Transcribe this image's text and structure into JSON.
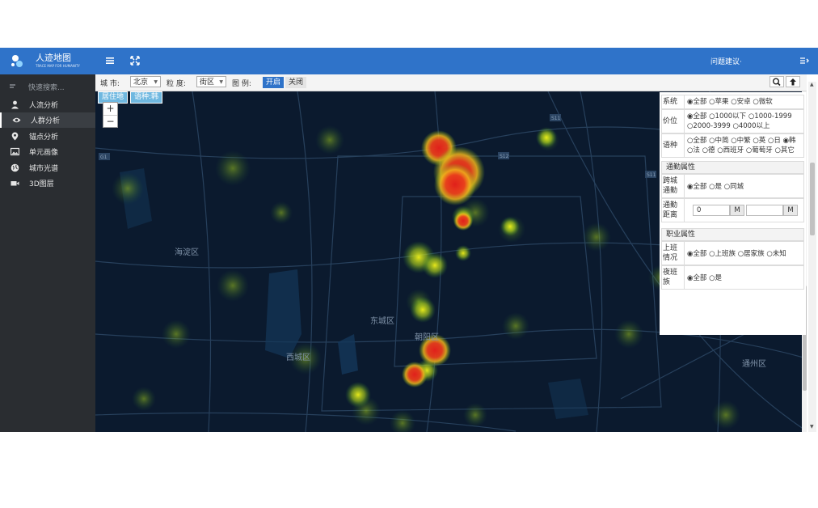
{
  "header": {
    "app_title": "人迹地图",
    "app_subtitle": "TRACE MAP FOR HUMANITY",
    "feedback": "问题建议·",
    "colors": {
      "bar": "#2f73c9",
      "sidebar": "#2a2d31"
    }
  },
  "sidebar": {
    "search_placeholder": "快速搜索...",
    "items": [
      {
        "label": "人流分析",
        "icon": "person-icon"
      },
      {
        "label": "人群分析",
        "icon": "eye-icon"
      },
      {
        "label": "锚点分析",
        "icon": "map-pin-icon"
      },
      {
        "label": "单元画像",
        "icon": "image-icon"
      },
      {
        "label": "城市光谱",
        "icon": "globe-icon"
      },
      {
        "label": "3D图层",
        "icon": "video-camera-icon"
      }
    ]
  },
  "toolbar": {
    "city_label": "城 市:",
    "city_value": "北京",
    "granularity_label": "粒 度:",
    "granularity_value": "街区",
    "legend_label": "图 例:",
    "legend_on": "开启",
    "legend_off": "关闭"
  },
  "map": {
    "tags": [
      "居住地",
      "语种:韩"
    ],
    "zoom_in": "+",
    "zoom_out": "−",
    "districts": [
      "海淀区",
      "东城区",
      "朝阳区",
      "西城区",
      "通州区"
    ],
    "road_shields": [
      "G1",
      "S11",
      "S12",
      "S11",
      "S5"
    ]
  },
  "filters": {
    "system": {
      "label": "系统",
      "options": "◉全部 ○苹果 ○安卓 ○微软"
    },
    "price": {
      "label": "价位",
      "options": "◉全部 ○1000以下 ○1000-1999 ○2000-3999 ○4000以上"
    },
    "language": {
      "label": "语种",
      "options": "○全部 ○中简 ○中繁 ○英 ○日 ◉韩 ○法 ○德 ○西班牙 ○葡萄牙 ○其它"
    },
    "commute_section": "通勤属性",
    "cross_city": {
      "label": "跨城通勤",
      "options": "◉全部 ○是 ○同城"
    },
    "distance": {
      "label": "通勤距离",
      "from": "0",
      "unit": "M",
      "to": "",
      "unit2": "M"
    },
    "job_section": "职业属性",
    "work": {
      "label": "上班情况",
      "options": "◉全部 ○上班族 ○居家族 ○未知"
    },
    "night": {
      "label": "夜班族",
      "options": "◉全部 ○是"
    }
  }
}
